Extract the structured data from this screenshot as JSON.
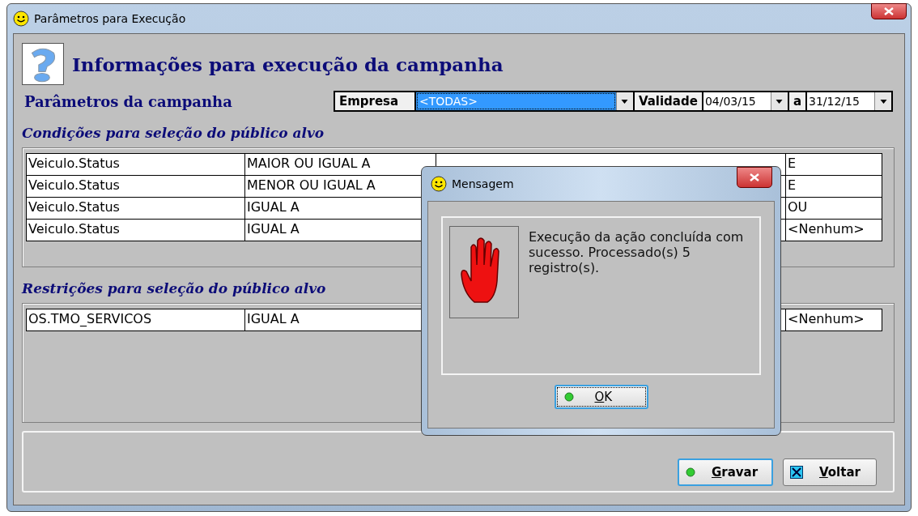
{
  "window": {
    "title": "Parâmetros para Execução"
  },
  "header": {
    "title": "Informações para execução da campanha"
  },
  "parameters": {
    "label": "Parâmetros da campanha",
    "empresa_label": "Empresa",
    "empresa_value": "<TODAS>",
    "validade_label": "Validade",
    "date_from": "04/03/15",
    "separator": "a",
    "date_to": "31/12/15"
  },
  "conditions": {
    "title": "Condições para seleção do público alvo",
    "rows": [
      {
        "field": "Veiculo.Status",
        "operator": "MAIOR OU IGUAL A",
        "connector": "E"
      },
      {
        "field": "Veiculo.Status",
        "operator": "MENOR OU IGUAL A",
        "connector": "E"
      },
      {
        "field": "Veiculo.Status",
        "operator": "IGUAL A",
        "connector": "OU"
      },
      {
        "field": "Veiculo.Status",
        "operator": "IGUAL A",
        "connector": "<Nenhum>"
      }
    ]
  },
  "restrictions": {
    "title": "Restrições para seleção do público alvo",
    "rows": [
      {
        "field": "OS.TMO_SERVICOS",
        "operator": "IGUAL A",
        "connector": "<Nenhum>"
      }
    ]
  },
  "buttons": [
    {
      "label": "Gravar",
      "kind": "save"
    },
    {
      "label": "Voltar",
      "kind": "back"
    }
  ],
  "dialog": {
    "title": "Mensagem",
    "message": "Execução da ação concluída com sucesso. Processado(s) 5 registro(s).",
    "button": "OK"
  }
}
